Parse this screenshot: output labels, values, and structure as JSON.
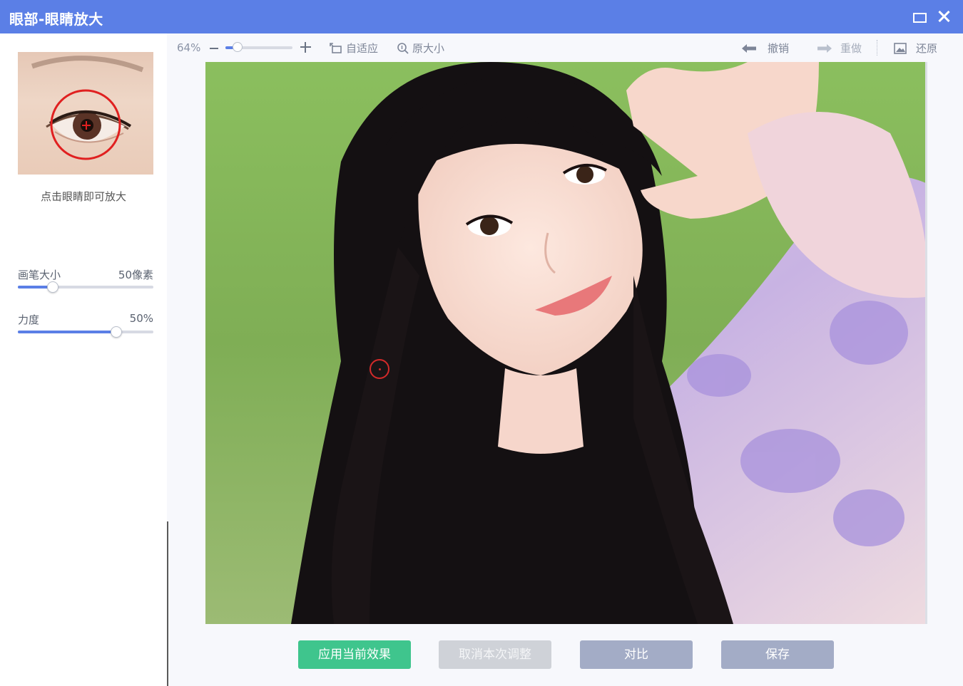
{
  "window": {
    "title": "眼部-眼睛放大"
  },
  "sidebar": {
    "hint": "点击眼睛即可放大",
    "brush_size": {
      "label": "画笔大小",
      "value_text": "50像素",
      "level": 0.25
    },
    "strength": {
      "label": "力度",
      "value_text": "50%",
      "level": 0.72
    }
  },
  "toolbar": {
    "zoom_percent": "64%",
    "zoom_level": 0.17,
    "fit_label": "自适应",
    "original_size_label": "原大小",
    "undo_label": "撤销",
    "redo_label": "重做",
    "restore_label": "还原"
  },
  "actions": {
    "apply": "应用当前效果",
    "cancel": "取消本次调整",
    "compare": "对比",
    "save": "保存"
  },
  "colors": {
    "titlebar": "#5b7fe6",
    "accent": "#5b7fe6",
    "apply_button": "#3fc58d",
    "disabled_button": "#cfd2d8",
    "secondary_button": "#a3acc6"
  }
}
